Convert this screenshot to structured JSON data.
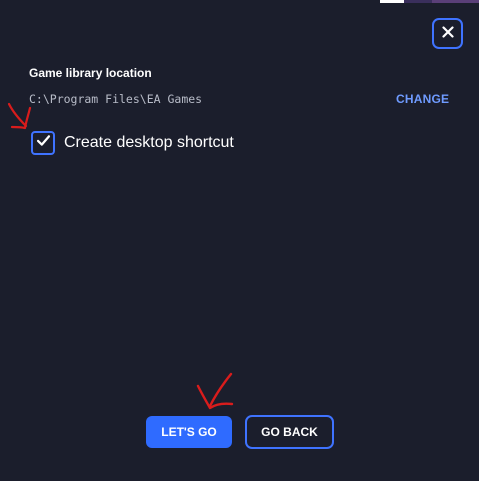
{
  "dialog": {
    "close_icon": "close-icon",
    "library_label": "Game library location",
    "library_path": "C:\\Program Files\\EA Games",
    "change_label": "CHANGE",
    "shortcut": {
      "label": "Create desktop shortcut",
      "checked": true,
      "icon": "checkmark-icon"
    },
    "primary_button_label": "LET'S GO",
    "secondary_button_label": "GO BACK"
  },
  "colors": {
    "background": "#1b1e2c",
    "accent_blue": "#3f73ff",
    "primary_button": "#2f6bff",
    "link": "#6f9bff",
    "annotation_red": "#d91c1c"
  },
  "annotations": [
    {
      "icon": "red-arrow-icon",
      "target": "shortcut-checkbox"
    },
    {
      "icon": "red-arrow-icon",
      "target": "lets-go-button"
    }
  ]
}
